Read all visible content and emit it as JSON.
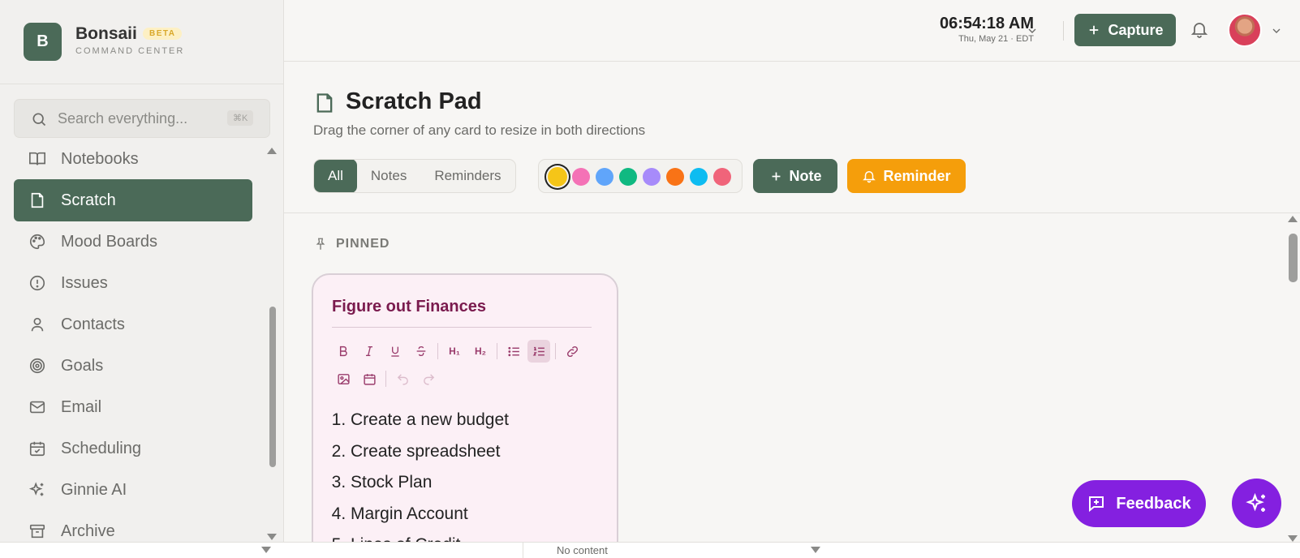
{
  "brand": {
    "logo_letter": "B",
    "name": "Bonsaii",
    "badge": "BETA",
    "subtitle": "COMMAND CENTER"
  },
  "search": {
    "placeholder": "Search everything...",
    "shortcut": "⌘K"
  },
  "nav": {
    "items": [
      {
        "label": "Notebooks",
        "icon": "book-icon"
      },
      {
        "label": "Scratch",
        "icon": "file-icon",
        "active": true
      },
      {
        "label": "Mood Boards",
        "icon": "palette-icon"
      },
      {
        "label": "Issues",
        "icon": "alert-circle-icon"
      },
      {
        "label": "Contacts",
        "icon": "user-icon"
      },
      {
        "label": "Goals",
        "icon": "target-icon"
      },
      {
        "label": "Email",
        "icon": "mail-icon"
      },
      {
        "label": "Scheduling",
        "icon": "calendar-check-icon"
      },
      {
        "label": "Ginnie AI",
        "icon": "sparkles-icon"
      },
      {
        "label": "Archive",
        "icon": "archive-icon"
      }
    ]
  },
  "topbar": {
    "time": "06:54:18 AM",
    "date": "Thu, May 21 · EDT",
    "capture_label": "Capture"
  },
  "page": {
    "title": "Scratch Pad",
    "subtitle": "Drag the corner of any card to resize in both directions",
    "filters": [
      "All",
      "Notes",
      "Reminders"
    ],
    "active_filter": "All",
    "colors": [
      "#f5c518",
      "#f472b6",
      "#60a5fa",
      "#10b981",
      "#a78bfa",
      "#f97316",
      "#0ebcf1",
      "#f0647a"
    ],
    "selected_color": "#f5c518",
    "note_label": "Note",
    "reminder_label": "Reminder"
  },
  "pinned": {
    "label": "PINNED",
    "card": {
      "title": "Figure out Finances",
      "items": [
        "Create a new budget",
        "Create spreadsheet",
        "Stock Plan",
        "Margin Account",
        "Lines of Credit"
      ]
    }
  },
  "fab": {
    "feedback_label": "Feedback"
  },
  "bottom": {
    "status": "No content"
  },
  "accent": {
    "green": "#4b6a58",
    "amber": "#f59e0b",
    "purple": "#8420e0"
  }
}
